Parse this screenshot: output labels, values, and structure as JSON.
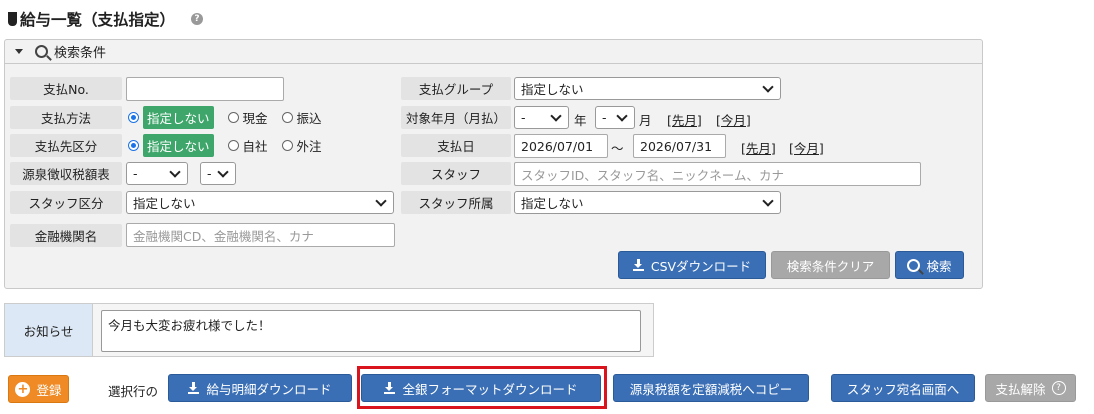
{
  "page": {
    "title": "給与一覧（支払指定）",
    "help": "?"
  },
  "search": {
    "header": "検索条件",
    "labels": {
      "shiharai_no": "支払No.",
      "shiharai_houhou": "支払方法",
      "shiharaisaki_kubun": "支払先区分",
      "gensen": "源泉徴収税額表",
      "staff_kubun": "スタッフ区分",
      "kinyu": "金融機関名",
      "group": "支払グループ",
      "taisho": "対象年月（月払）",
      "shiharaibi": "支払日",
      "staff": "スタッフ",
      "shozoku": "スタッフ所属"
    },
    "shiharai_no_value": "",
    "houhou_options": [
      "指定しない",
      "現金",
      "振込"
    ],
    "kubun_options": [
      "指定しない",
      "自社",
      "外注"
    ],
    "gensen_select1": "-",
    "gensen_select2": "-",
    "staff_kubun_value": "指定しない",
    "kinyu_placeholder": "金融機関CD、金融機関名、カナ",
    "group_value": "指定しない",
    "taisho_year": "-",
    "taisho_year_unit": "年",
    "taisho_month": "-",
    "taisho_month_unit": "月",
    "prev_month_link": "[先月]",
    "this_month_link": "[今月]",
    "date_from": "2026/07/01",
    "date_sep": "～",
    "date_to": "2026/07/31",
    "staff_placeholder": "スタッフID、スタッフ名、ニックネーム、カナ",
    "shozoku_value": "指定しない",
    "buttons": {
      "csv": "CSVダウンロード",
      "clear": "検索条件クリア",
      "search": "検索"
    }
  },
  "notice": {
    "label": "お知らせ",
    "text": "今月も大変お疲れ様でした！"
  },
  "actions": {
    "register": "登録",
    "selected_rows": "選択行の",
    "kyuyo_dl": "給与明細ダウンロード",
    "zengin_dl": "全銀フォーマットダウンロード",
    "gensen_copy": "源泉税額を定額減税へコピー",
    "staff_atena": "スタッフ宛名画面へ",
    "kaijo": "支払解除",
    "kaijo_help": "?"
  },
  "colors": {
    "primary": "#3a6fb6",
    "accent_green": "#3fa66b",
    "orange": "#f08a24",
    "highlight": "#d9141c"
  }
}
